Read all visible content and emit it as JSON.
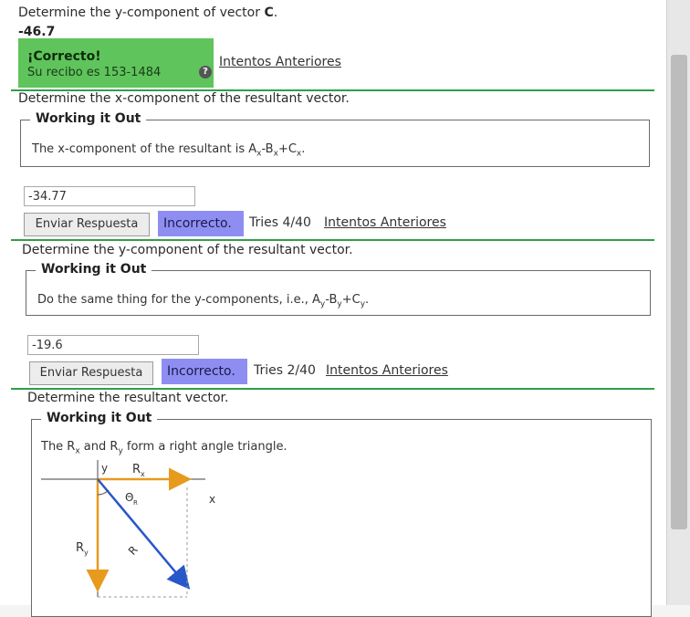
{
  "prev_question": {
    "prompt": "Determine the y-component of vector ",
    "vector_letter": "C",
    "prompt_end": ".",
    "answer": "-46.7",
    "status_title": "¡Correcto!",
    "receipt": "Su recibo es 153-1484",
    "help_icon": "?",
    "prev_attempts_link": "Intentos Anteriores"
  },
  "q_x": {
    "prompt": "Determine the x-component of the resultant vector.",
    "hint_title": "Working it Out",
    "hint_text": "The x-component of the resultant is A",
    "sub1": "x",
    "op1": "-B",
    "sub2": "x",
    "op2": "+C",
    "sub3": "x",
    "end": ".",
    "input_value": "-34.77",
    "submit_label": "Enviar Respuesta",
    "status": "Incorrecto.",
    "tries": "Tries 4/40",
    "prev_attempts_link": "Intentos Anteriores"
  },
  "q_y": {
    "prompt": "Determine the y-component of the resultant vector.",
    "hint_title": "Working it Out",
    "hint_text": "Do the same thing for the y-components, i.e., A",
    "sub1": "y",
    "op1": "-B",
    "sub2": "y",
    "op2": "+C",
    "sub3": "y",
    "end": ".",
    "input_value": "-19.6",
    "submit_label": "Enviar Respuesta",
    "status": "Incorrecto.",
    "tries": "Tries 2/40",
    "prev_attempts_link": "Intentos Anteriores"
  },
  "q_r": {
    "prompt": "Determine the resultant vector.",
    "hint_title": "Working it Out",
    "hint_a": "The R",
    "hint_sub1": "x",
    "hint_b": " and R",
    "hint_sub2": "y",
    "hint_c": " form a right angle triangle.",
    "diagram": {
      "y_label": "y",
      "x_label": "x",
      "rx_label": "R",
      "rx_sub": "x",
      "ry_label": "R",
      "ry_sub": "y",
      "theta_label": "Θ",
      "theta_sub": "R",
      "r_label": "R"
    }
  },
  "colors": {
    "correct_bg": "#5fc45b",
    "incorrect_bg": "#8e8ef2",
    "vector_orange": "#e89a1e",
    "vector_blue": "#2857c9"
  }
}
